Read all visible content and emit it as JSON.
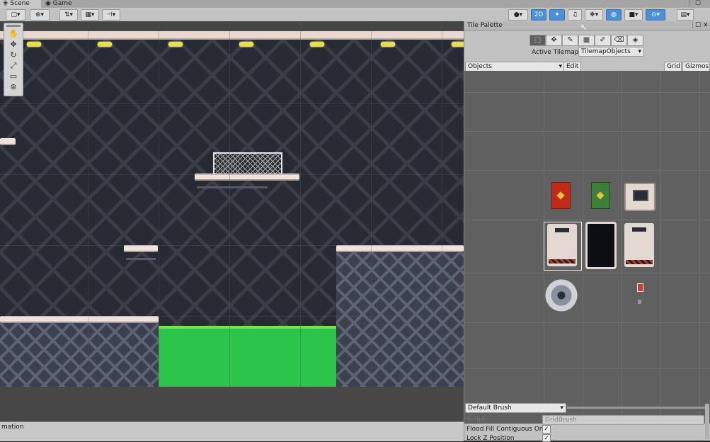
{
  "tabs": [
    {
      "label": "Scene",
      "icon": "scene-grid-icon"
    },
    {
      "label": "Game",
      "icon": "game-pad-icon"
    }
  ],
  "toolbar": {
    "right_button_2d": "2D",
    "view_tools": [
      "hand-icon",
      "move-icon",
      "rotate-icon",
      "scale-icon",
      "rect-icon",
      "transform-icon"
    ]
  },
  "tile_palette": {
    "title": "Tile Palette",
    "tools": [
      "select-icon",
      "move-icon",
      "paint-brush-icon",
      "box-fill-icon",
      "picker-icon",
      "eraser-icon",
      "fill-icon"
    ],
    "active_tilemap_label": "Active Tilemap",
    "active_tilemap_value": "TilemapObjects",
    "palette_name": "Objects",
    "edit_label": "Edit",
    "grid_label": "Grid",
    "gizmos_label": "Gizmos",
    "brush": {
      "name": "Default Brush",
      "script_label": "Script",
      "script_value": "GridBrush",
      "flood_fill_label": "Flood Fill Contiguous Only",
      "flood_fill_checked": true,
      "lock_z_label": "Lock Z Position",
      "lock_z_checked": true
    },
    "tiles": [
      "red-door-tile",
      "green-door-tile",
      "screen-block-tile",
      "door-frame-tile",
      "dark-door-tile",
      "door-frame-tile-2",
      "saw-blade-tile",
      "red-light-tile"
    ]
  },
  "status": {
    "text": "mation"
  },
  "colors": {
    "acid": "#2cc44b",
    "wall": "#282a33",
    "platform": "#eee2dc",
    "accent": "#4b8fd8"
  }
}
